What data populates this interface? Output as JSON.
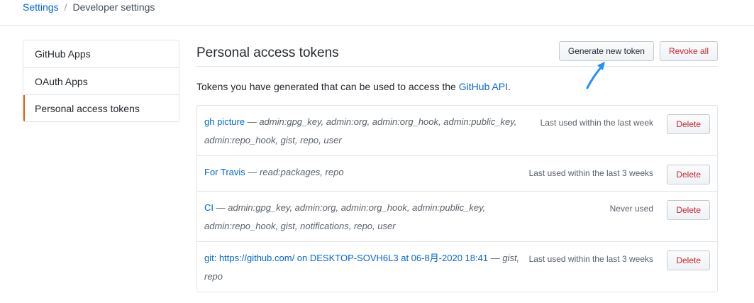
{
  "breadcrumb": {
    "root": "Settings",
    "separator": "/",
    "current": "Developer settings"
  },
  "sidebar": {
    "items": [
      {
        "label": "GitHub Apps"
      },
      {
        "label": "OAuth Apps"
      },
      {
        "label": "Personal access tokens"
      }
    ]
  },
  "main": {
    "title": "Personal access tokens",
    "generate_label": "Generate new token",
    "revoke_label": "Revoke all",
    "intro_text": "Tokens you have generated that can be used to access the ",
    "intro_link": "GitHub API",
    "intro_end": "."
  },
  "tokens": [
    {
      "name": "gh picture",
      "sep": " — ",
      "scopes": "admin:gpg_key, admin:org, admin:org_hook, admin:public_key, admin:repo_hook, gist, repo, user",
      "usage": "Last used within the last week",
      "delete_label": "Delete"
    },
    {
      "name": "For Travis",
      "sep": " — ",
      "scopes": "read:packages, repo",
      "usage": "Last used within the last 3 weeks",
      "delete_label": "Delete"
    },
    {
      "name": "CI",
      "sep": " — ",
      "scopes": "admin:gpg_key, admin:org, admin:org_hook, admin:public_key, admin:repo_hook, gist, notifications, repo, user",
      "usage": "Never used",
      "delete_label": "Delete"
    },
    {
      "name": "git: https://github.com/ on DESKTOP-SOVH6L3 at 06-8月-2020 18:41",
      "sep": " — ",
      "scopes": "gist, repo",
      "usage": "Last used within the last 3 weeks",
      "delete_label": "Delete"
    }
  ],
  "colors": {
    "link": "#0366d6",
    "danger": "#cb2431",
    "active_indicator": "#e36209",
    "annotation_arrow": "#1e90ff"
  },
  "icons": {
    "annotation": "arrow-pointer-icon"
  }
}
